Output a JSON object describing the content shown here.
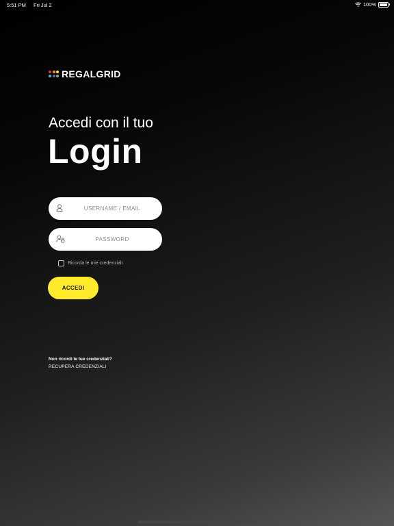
{
  "status_bar": {
    "time": "5:51 PM",
    "date": "Fri Jul 2",
    "battery": "100%"
  },
  "brand": {
    "name": "REGALGRID",
    "dot_colors": [
      "#e53935",
      "#ff9800",
      "#ffeb3b",
      "#26c6da",
      "#7e57c2",
      "#66bb6a"
    ]
  },
  "login": {
    "subtitle": "Accedi con il tuo",
    "title": "Login",
    "username_placeholder": "USERNAME / EMAIL",
    "username_icon": "user-icon",
    "password_placeholder": "PASSWORD",
    "password_icon": "user-lock-icon",
    "remember_label": "Ricorda le mie credenziali",
    "remember_checked": false,
    "submit_label": "ACCEDI",
    "accent_color": "#ffea2c"
  },
  "recovery": {
    "question": "Non ricordi le tue credenziali?",
    "link_label": "RECUPERA CREDENZIALI"
  }
}
